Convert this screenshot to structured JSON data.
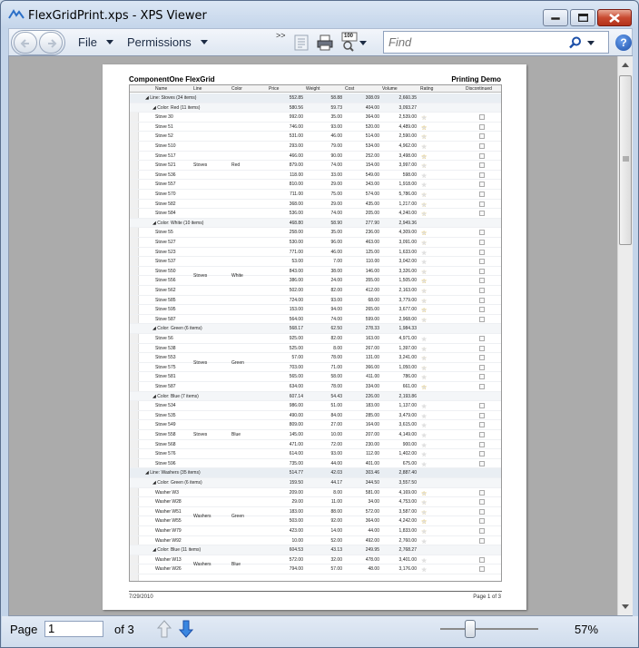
{
  "window": {
    "title": "FlexGridPrint.xps - XPS Viewer"
  },
  "toolbar": {
    "file_label": "File",
    "permissions_label": "Permissions",
    "overflow_label": ">>",
    "zoom_badge": "100",
    "find_placeholder": "Find",
    "help_label": "?"
  },
  "document": {
    "title_left": "ComponentOne FlexGrid",
    "title_right": "Printing Demo",
    "date": "7/29/2010",
    "page_label": "Page 1 of 3",
    "columns": [
      "Name",
      "Line",
      "Color",
      "Price",
      "Weight",
      "Cost",
      "Volume",
      "Rating",
      "Discontinued"
    ],
    "rows": [
      {
        "type": "g1",
        "label": "Line: Stoves (34 items)",
        "price": "552.85",
        "weight": "58.88",
        "cost": "308.09",
        "volume": "2,660.35"
      },
      {
        "type": "g2",
        "label": "Color: Red (11 items)",
        "price": "580.56",
        "weight": "59.73",
        "cost": "404.00",
        "volume": "3,093.27"
      },
      {
        "name": "Stove 30",
        "price": "992.00",
        "weight": "35.00",
        "cost": "364.00",
        "volume": "2,539.00",
        "rating": 2
      },
      {
        "name": "Stove 51",
        "price": "746.00",
        "weight": "93.00",
        "cost": "520.00",
        "volume": "4,489.00",
        "rating": 4
      },
      {
        "name": "Stove 52",
        "price": "531.00",
        "weight": "46.00",
        "cost": "514.00",
        "volume": "2,590.00",
        "rating": 3
      },
      {
        "name": "Stove 510",
        "price": "293.00",
        "weight": "79.00",
        "cost": "534.00",
        "volume": "4,962.00",
        "rating": 1
      },
      {
        "name": "Stove 517",
        "price": "466.00",
        "weight": "90.00",
        "cost": "252.00",
        "volume": "3,498.00",
        "rating": 4
      },
      {
        "name": "Stove 521",
        "price": "879.00",
        "weight": "74.00",
        "cost": "154.00",
        "volume": "3,997.00",
        "rating": 2
      },
      {
        "name": "Stove 536",
        "price": "118.00",
        "weight": "33.00",
        "cost": "549.00",
        "volume": "598.00",
        "rating": 0
      },
      {
        "name": "Stove 557",
        "price": "810.00",
        "weight": "29.00",
        "cost": "343.00",
        "volume": "1,918.00",
        "rating": 0
      },
      {
        "name": "Stove 570",
        "price": "711.00",
        "weight": "75.00",
        "cost": "574.00",
        "volume": "5,786.00",
        "rating": 2
      },
      {
        "name": "Stove 582",
        "price": "368.00",
        "weight": "29.00",
        "cost": "435.00",
        "volume": "1,217.00",
        "rating": 3
      },
      {
        "name": "Stove 584",
        "price": "536.00",
        "weight": "74.00",
        "cost": "205.00",
        "volume": "4,240.00",
        "rating": 3
      },
      {
        "type": "g2",
        "label": "Color: White (10 items)",
        "price": "468.80",
        "weight": "58.90",
        "cost": "277.90",
        "volume": "2,949.36"
      },
      {
        "name": "Stove 55",
        "price": "258.00",
        "weight": "35.00",
        "cost": "236.00",
        "volume": "4,309.00",
        "rating": 4
      },
      {
        "name": "Stove 527",
        "price": "530.00",
        "weight": "96.00",
        "cost": "463.00",
        "volume": "3,091.00",
        "rating": 2
      },
      {
        "name": "Stove 523",
        "price": "771.00",
        "weight": "46.00",
        "cost": "125.00",
        "volume": "1,633.00",
        "rating": 0
      },
      {
        "name": "Stove 537",
        "price": "53.00",
        "weight": "7.00",
        "cost": "110.00",
        "volume": "3,042.00",
        "rating": 0
      },
      {
        "name": "Stove 550",
        "price": "843.00",
        "weight": "38.00",
        "cost": "146.00",
        "volume": "3,326.00",
        "rating": 2
      },
      {
        "name": "Stove 556",
        "price": "386.00",
        "weight": "24.00",
        "cost": "355.00",
        "volume": "1,505.00",
        "rating": 4
      },
      {
        "name": "Stove 562",
        "price": "502.00",
        "weight": "82.00",
        "cost": "412.00",
        "volume": "2,163.00",
        "rating": 2
      },
      {
        "name": "Stove 585",
        "price": "724.00",
        "weight": "93.00",
        "cost": "68.00",
        "volume": "3,779.00",
        "rating": 2
      },
      {
        "name": "Stove 595",
        "price": "153.00",
        "weight": "94.00",
        "cost": "265.00",
        "volume": "3,677.00",
        "rating": 4
      },
      {
        "name": "Stove 587",
        "price": "564.00",
        "weight": "74.00",
        "cost": "599.00",
        "volume": "2,968.00",
        "rating": 2
      },
      {
        "type": "g2",
        "label": "Color: Green (6 items)",
        "price": "568.17",
        "weight": "62.50",
        "cost": "278.33",
        "volume": "1,984.33"
      },
      {
        "name": "Stove 56",
        "price": "925.00",
        "weight": "82.00",
        "cost": "163.00",
        "volume": "4,971.00",
        "rating": 0
      },
      {
        "name": "Stove 538",
        "price": "525.00",
        "weight": "8.00",
        "cost": "267.00",
        "volume": "1,397.00",
        "rating": 1
      },
      {
        "name": "Stove 553",
        "price": "57.00",
        "weight": "78.00",
        "cost": "131.00",
        "volume": "3,241.00",
        "rating": 2
      },
      {
        "name": "Stove 575",
        "price": "703.00",
        "weight": "71.00",
        "cost": "366.00",
        "volume": "1,050.00",
        "rating": 2
      },
      {
        "name": "Stove 581",
        "price": "565.00",
        "weight": "58.00",
        "cost": "411.00",
        "volume": "786.00",
        "rating": 1
      },
      {
        "name": "Stove 587",
        "price": "634.00",
        "weight": "78.00",
        "cost": "334.00",
        "volume": "661.00",
        "rating": 4
      },
      {
        "type": "g2",
        "label": "Color: Blue (7 items)",
        "price": "607.14",
        "weight": "54.43",
        "cost": "226.00",
        "volume": "2,193.86"
      },
      {
        "name": "Stove 534",
        "price": "986.00",
        "weight": "51.00",
        "cost": "183.00",
        "volume": "1,137.00",
        "rating": 0
      },
      {
        "name": "Stove 535",
        "price": "490.00",
        "weight": "84.00",
        "cost": "285.00",
        "volume": "3,479.00",
        "rating": 0
      },
      {
        "name": "Stove 549",
        "price": "809.00",
        "weight": "27.00",
        "cost": "164.00",
        "volume": "3,615.00",
        "rating": 0
      },
      {
        "name": "Stove 558",
        "price": "145.00",
        "weight": "10.00",
        "cost": "207.00",
        "volume": "4,149.00",
        "rating": 0
      },
      {
        "name": "Stove 568",
        "price": "471.00",
        "weight": "72.00",
        "cost": "230.00",
        "volume": "900.00",
        "rating": 0
      },
      {
        "name": "Stove 576",
        "price": "614.00",
        "weight": "93.00",
        "cost": "112.00",
        "volume": "1,402.00",
        "rating": 0
      },
      {
        "name": "Stove 596",
        "price": "735.00",
        "weight": "44.00",
        "cost": "401.00",
        "volume": "675.00",
        "rating": 0
      },
      {
        "type": "g1",
        "label": "Line: Washers (35 items)",
        "price": "514.77",
        "weight": "42.03",
        "cost": "303.46",
        "volume": "2,887.40"
      },
      {
        "type": "g2",
        "label": "Color: Green (6 items)",
        "price": "159.50",
        "weight": "44.17",
        "cost": "344.50",
        "volume": "3,557.50"
      },
      {
        "name": "Washer W3",
        "price": "209.00",
        "weight": "8.00",
        "cost": "581.00",
        "volume": "4,169.00",
        "rating": 4
      },
      {
        "name": "Washer W28",
        "price": "29.00",
        "weight": "11.00",
        "cost": "34.00",
        "volume": "4,753.00",
        "rating": 2
      },
      {
        "name": "Washer W51",
        "price": "183.00",
        "weight": "88.00",
        "cost": "572.00",
        "volume": "3,587.00",
        "rating": 3
      },
      {
        "name": "Washer W55",
        "price": "503.00",
        "weight": "92.00",
        "cost": "364.00",
        "volume": "4,242.00",
        "rating": 4
      },
      {
        "name": "Washer W79",
        "price": "423.00",
        "weight": "14.00",
        "cost": "44.00",
        "volume": "1,833.00",
        "rating": 2
      },
      {
        "name": "Washer W92",
        "price": "10.00",
        "weight": "52.00",
        "cost": "492.00",
        "volume": "2,760.00",
        "rating": 0
      },
      {
        "type": "g2",
        "label": "Color: Blue (11 items)",
        "price": "604.53",
        "weight": "43.13",
        "cost": "249.95",
        "volume": "2,768.27"
      },
      {
        "name": "Washer W13",
        "price": "572.00",
        "weight": "32.00",
        "cost": "478.00",
        "volume": "3,401.00",
        "rating": 0
      },
      {
        "name": "Washer W26",
        "price": "794.00",
        "weight": "57.00",
        "cost": "48.00",
        "volume": "3,176.00",
        "rating": 0
      }
    ],
    "merged": [
      {
        "line": "Stoves",
        "color": "Red"
      },
      {
        "line": "Stoves",
        "color": "White"
      },
      {
        "line": "Stoves",
        "color": "Green"
      },
      {
        "line": "Stoves",
        "color": "Blue"
      },
      {
        "line": "Washers",
        "color": "Green"
      },
      {
        "line": "Washers",
        "color": "Blue"
      }
    ]
  },
  "status": {
    "page_label": "Page",
    "page_value": "1",
    "of_label": "of 3",
    "zoom_text": "57%",
    "zoom_percent": 57
  },
  "colors": {
    "accent": "#1c4fa8",
    "star": "#e7b316",
    "title_close": "#c84a31"
  }
}
